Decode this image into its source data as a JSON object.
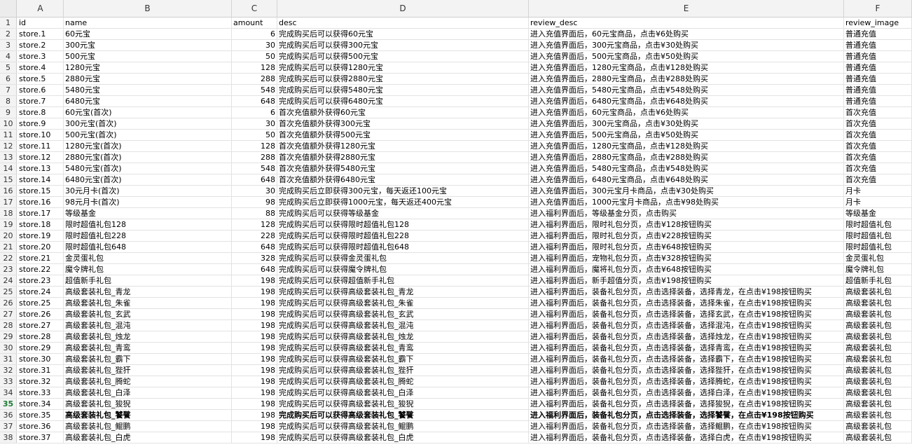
{
  "columns": [
    "A",
    "B",
    "C",
    "D",
    "E",
    "F"
  ],
  "active_row": "35",
  "rows": [
    {
      "n": "1",
      "c": [
        "id",
        "name",
        "amount",
        "desc",
        "review_desc",
        "review_image"
      ]
    },
    {
      "n": "2",
      "c": [
        "store.1",
        "60元宝",
        "6",
        "完成购买后可以获得60元宝",
        "进入充值界面后，60元宝商品，点击¥6处购买",
        "普通充值"
      ]
    },
    {
      "n": "3",
      "c": [
        "store.2",
        "300元宝",
        "30",
        "完成购买后可以获得300元宝",
        "进入充值界面后，300元宝商品，点击¥30处购买",
        "普通充值"
      ]
    },
    {
      "n": "4",
      "c": [
        "store.3",
        "500元宝",
        "50",
        "完成购买后可以获得500元宝",
        "进入充值界面后，500元宝商品，点击¥50处购买",
        "普通充值"
      ]
    },
    {
      "n": "5",
      "c": [
        "store.4",
        "1280元宝",
        "128",
        "完成购买后可以获得1280元宝",
        "进入充值界面后，1280元宝商品，点击¥128处购买",
        "普通充值"
      ]
    },
    {
      "n": "6",
      "c": [
        "store.5",
        "2880元宝",
        "288",
        "完成购买后可以获得2880元宝",
        "进入充值界面后，2880元宝商品，点击¥288处购买",
        "普通充值"
      ]
    },
    {
      "n": "7",
      "c": [
        "store.6",
        "5480元宝",
        "548",
        "完成购买后可以获得5480元宝",
        "进入充值界面后，5480元宝商品，点击¥548处购买",
        "普通充值"
      ]
    },
    {
      "n": "8",
      "c": [
        "store.7",
        "6480元宝",
        "648",
        "完成购买后可以获得6480元宝",
        "进入充值界面后，6480元宝商品，点击¥648处购买",
        "普通充值"
      ]
    },
    {
      "n": "9",
      "c": [
        "store.8",
        "60元宝(首次)",
        "6",
        "首次充值额外获得60元宝",
        "进入充值界面后，60元宝商品，点击¥6处购买",
        "首次充值"
      ]
    },
    {
      "n": "10",
      "c": [
        "store.9",
        "300元宝(首次)",
        "30",
        "首次充值额外获得300元宝",
        "进入充值界面后，300元宝商品，点击¥30处购买",
        "首次充值"
      ]
    },
    {
      "n": "11",
      "c": [
        "store.10",
        "500元宝(首次)",
        "50",
        "首次充值额外获得500元宝",
        "进入充值界面后，500元宝商品，点击¥50处购买",
        "首次充值"
      ]
    },
    {
      "n": "12",
      "c": [
        "store.11",
        "1280元宝(首次)",
        "128",
        "首次充值额外获得1280元宝",
        "进入充值界面后，1280元宝商品，点击¥128处购买",
        "首次充值"
      ]
    },
    {
      "n": "13",
      "c": [
        "store.12",
        "2880元宝(首次)",
        "288",
        "首次充值额外获得2880元宝",
        "进入充值界面后，2880元宝商品，点击¥288处购买",
        "首次充值"
      ]
    },
    {
      "n": "14",
      "c": [
        "store.13",
        "5480元宝(首次)",
        "548",
        "首次充值额外获得5480元宝",
        "进入充值界面后，5480元宝商品，点击¥548处购买",
        "首次充值"
      ]
    },
    {
      "n": "15",
      "c": [
        "store.14",
        "6480元宝(首次)",
        "648",
        "首次充值额外获得6480元宝",
        "进入充值界面后，6480元宝商品，点击¥648处购买",
        "首次充值"
      ]
    },
    {
      "n": "16",
      "c": [
        "store.15",
        "30元月卡(首次)",
        "30",
        "完成购买后立即获得300元宝，每天返还100元宝",
        "进入充值界面后，300元宝月卡商品，点击¥30处购买",
        "月卡"
      ]
    },
    {
      "n": "17",
      "c": [
        "store.16",
        "98元月卡(首次)",
        "98",
        "完成购买后立即获得1000元宝，每天返还400元宝",
        "进入充值界面后，1000元宝月卡商品，点击¥98处购买",
        "月卡"
      ]
    },
    {
      "n": "18",
      "c": [
        "store.17",
        "等级基金",
        "88",
        "完成购买后可以获得等级基金",
        "进入福利界面后，等级基金分页，点击购买",
        "等级基金"
      ]
    },
    {
      "n": "19",
      "c": [
        "store.18",
        "限时超值礼包128",
        "128",
        "完成购买后可以获得限时超值礼包128",
        "进入福利界面后，限时礼包分页，点击¥128按钮购买",
        "限时超值礼包"
      ]
    },
    {
      "n": "20",
      "c": [
        "store.19",
        "限时超值礼包228",
        "228",
        "完成购买后可以获得限时超值礼包228",
        "进入福利界面后，限时礼包分页，点击¥228按钮购买",
        "限时超值礼包"
      ]
    },
    {
      "n": "21",
      "c": [
        "store.20",
        "限时超值礼包648",
        "648",
        "完成购买后可以获得限时超值礼包648",
        "进入福利界面后，限时礼包分页，点击¥648按钮购买",
        "限时超值礼包"
      ]
    },
    {
      "n": "22",
      "c": [
        "store.21",
        "金灵蛋礼包",
        "328",
        "完成购买后可以获得金灵蛋礼包",
        "进入福利界面后，宠物礼包分页，点击¥328按钮购买",
        "金灵蛋礼包"
      ]
    },
    {
      "n": "23",
      "c": [
        "store.22",
        "魔令牌礼包",
        "648",
        "完成购买后可以获得魔令牌礼包",
        "进入福利界面后，魔将礼包分页，点击¥648按钮购买",
        "魔令牌礼包"
      ]
    },
    {
      "n": "24",
      "c": [
        "store.23",
        "超值新手礼包",
        "198",
        "完成购买后可以获得超值新手礼包",
        "进入福利界面后，新手超值分页，点击¥198按钮购买",
        "超值新手礼包"
      ]
    },
    {
      "n": "25",
      "c": [
        "store.24",
        "高级套装礼包_青龙",
        "198",
        "完成购买后可以获得高级套装礼包_青龙",
        "进入福利界面后，装备礼包分页，点击选择装备，选择青龙，在点击¥198按钮购买",
        "高级套装礼包"
      ]
    },
    {
      "n": "26",
      "c": [
        "store.25",
        "高级套装礼包_朱雀",
        "198",
        "完成购买后可以获得高级套装礼包_朱雀",
        "进入福利界面后，装备礼包分页，点击选择装备，选择朱雀，在点击¥198按钮购买",
        "高级套装礼包"
      ]
    },
    {
      "n": "27",
      "c": [
        "store.26",
        "高级套装礼包_玄武",
        "198",
        "完成购买后可以获得高级套装礼包_玄武",
        "进入福利界面后，装备礼包分页，点击选择装备，选择玄武，在点击¥198按钮购买",
        "高级套装礼包"
      ]
    },
    {
      "n": "28",
      "c": [
        "store.27",
        "高级套装礼包_混沌",
        "198",
        "完成购买后可以获得高级套装礼包_混沌",
        "进入福利界面后，装备礼包分页，点击选择装备，选择混沌，在点击¥198按钮购买",
        "高级套装礼包"
      ]
    },
    {
      "n": "29",
      "c": [
        "store.28",
        "高级套装礼包_烛龙",
        "198",
        "完成购买后可以获得高级套装礼包_烛龙",
        "进入福利界面后，装备礼包分页，点击选择装备，选择烛龙，在点击¥198按钮购买",
        "高级套装礼包"
      ]
    },
    {
      "n": "30",
      "c": [
        "store.29",
        "高级套装礼包_青鸾",
        "198",
        "完成购买后可以获得高级套装礼包_青鸾",
        "进入福利界面后，装备礼包分页，点击选择装备，选择青鸾，在点击¥198按钮购买",
        "高级套装礼包"
      ]
    },
    {
      "n": "31",
      "c": [
        "store.30",
        "高级套装礼包_霸下",
        "198",
        "完成购买后可以获得高级套装礼包_霸下",
        "进入福利界面后，装备礼包分页，点击选择装备，选择霸下，在点击¥198按钮购买",
        "高级套装礼包"
      ]
    },
    {
      "n": "32",
      "c": [
        "store.31",
        "高级套装礼包_狴犴",
        "198",
        "完成购买后可以获得高级套装礼包_狴犴",
        "进入福利界面后，装备礼包分页，点击选择装备，选择狴犴，在点击¥198按钮购买",
        "高级套装礼包"
      ]
    },
    {
      "n": "33",
      "c": [
        "store.32",
        "高级套装礼包_腾蛇",
        "198",
        "完成购买后可以获得高级套装礼包_腾蛇",
        "进入福利界面后，装备礼包分页，点击选择装备，选择腾蛇，在点击¥198按钮购买",
        "高级套装礼包"
      ]
    },
    {
      "n": "34",
      "c": [
        "store.33",
        "高级套装礼包_白泽",
        "198",
        "完成购买后可以获得高级套装礼包_白泽",
        "进入福利界面后，装备礼包分页，点击选择装备，选择白泽，在点击¥198按钮购买",
        "高级套装礼包"
      ]
    },
    {
      "n": "35",
      "c": [
        "store.34",
        "高级套装礼包_狻猊",
        "198",
        "完成购买后可以获得高级套装礼包_狻猊",
        "进入福利界面后，装备礼包分页，点击选择装备，选择狻猊，在点击¥198按钮购买",
        "高级套装礼包"
      ]
    },
    {
      "n": "36",
      "c": [
        "store.35",
        "高级套装礼包_饕餮",
        "198",
        "完成购买后可以获得高级套装礼包_饕餮",
        "进入福利界面后，装备礼包分页，点击选择装备，选择饕餮，在点击¥198按钮购买",
        "高级套装礼包"
      ]
    },
    {
      "n": "37",
      "c": [
        "store.36",
        "高级套装礼包_鲲鹏",
        "198",
        "完成购买后可以获得高级套装礼包_鲲鹏",
        "进入福利界面后，装备礼包分页，点击选择装备，选择鲲鹏，在点击¥198按钮购买",
        "高级套装礼包"
      ]
    },
    {
      "n": "38",
      "c": [
        "store.37",
        "高级套装礼包_白虎",
        "198",
        "完成购买后可以获得高级套装礼包_白虎",
        "进入福利界面后，装备礼包分页，点击选择装备，选择白虎，在点击¥198按钮购买",
        "高级套装礼包"
      ]
    }
  ]
}
